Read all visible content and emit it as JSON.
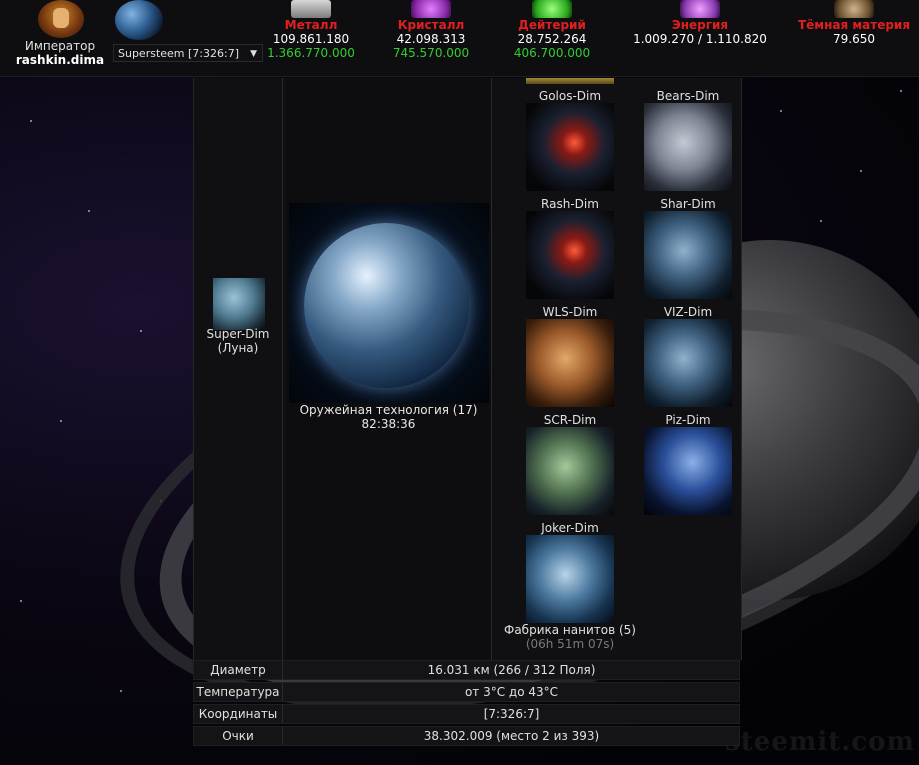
{
  "header": {
    "rank": "Император",
    "username": "rashkin.dima",
    "planet_selector": "Supersteem [7:326:7]",
    "resources": [
      {
        "name": "Металл",
        "amount": "109.861.180",
        "capacity": "1.366.770.000",
        "icon": "metal-icon",
        "color": "#e02020"
      },
      {
        "name": "Кристалл",
        "amount": "42.098.313",
        "capacity": "745.570.000",
        "icon": "crystal-icon",
        "color": "#e02020"
      },
      {
        "name": "Дейтерий",
        "amount": "28.752.264",
        "capacity": "406.700.000",
        "icon": "deuterium-icon",
        "color": "#e02020"
      },
      {
        "name": "Энергия",
        "amount": "1.009.270 / 1.110.820",
        "capacity": "",
        "icon": "energy-icon",
        "color": "#e02020"
      },
      {
        "name": "Тёмная материя",
        "amount": "79.650",
        "capacity": "",
        "icon": "dark-matter-icon",
        "color": "#e02020"
      }
    ]
  },
  "moon": {
    "name": "Super-Dim",
    "type": "(Луна)"
  },
  "current_build": {
    "title": "Оружейная технология (17)",
    "time": "82:38:36"
  },
  "planets": [
    {
      "name": "Golos-Dim"
    },
    {
      "name": "Bears-Dim"
    },
    {
      "name": "Rash-Dim"
    },
    {
      "name": "Shar-Dim"
    },
    {
      "name": "WLS-Dim"
    },
    {
      "name": "VIZ-Dim"
    },
    {
      "name": "SCR-Dim"
    },
    {
      "name": "Piz-Dim"
    },
    {
      "name": "Joker-Dim"
    }
  ],
  "factory": {
    "title": "Фабрика нанитов (5)",
    "time": "(06h 51m 07s)"
  },
  "info": [
    {
      "label": "Диаметр",
      "value": "16.031 км (266 / 312 Поля)"
    },
    {
      "label": "Температура",
      "value": "от 3°C до 43°C"
    },
    {
      "label": "Координаты",
      "value": "[7:326:7]"
    },
    {
      "label": "Очки",
      "value": "38.302.009 (место 2 из 393)"
    }
  ],
  "watermark": "steemit.com"
}
